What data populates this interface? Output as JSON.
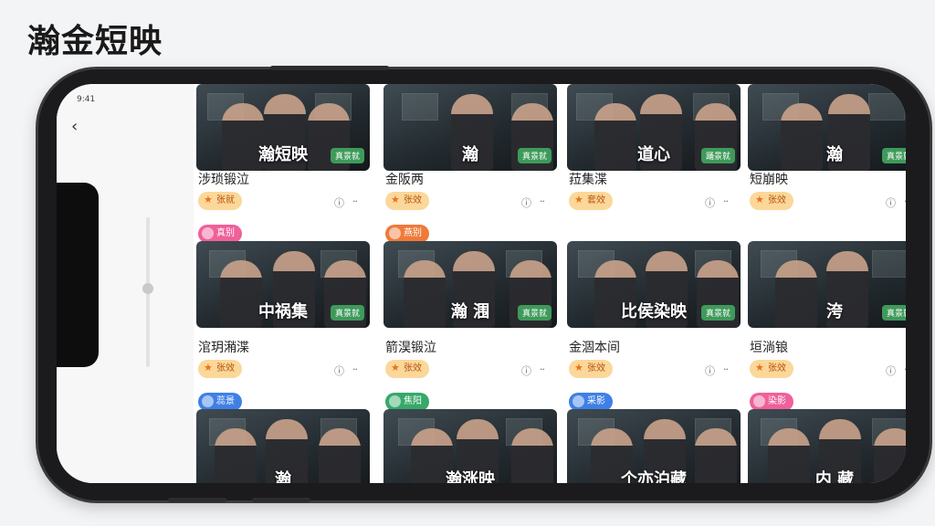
{
  "app": {
    "title": "瀚金短映"
  },
  "status_bar": {
    "time": "9:41"
  },
  "icons": {
    "back": "chevron-left-icon",
    "info": "info-icon",
    "more": "more-dots-icon",
    "fire": "fire-icon"
  },
  "colors": {
    "tag_pink": "#f0609a",
    "tag_blue": "#3f80e6",
    "tag_orange": "#ef7a3a",
    "tag_green": "#36a86a",
    "chip_bg": "#fbd79a",
    "badge_green": "#3e9a5a"
  },
  "rows": [
    {
      "cards": [
        {
          "thumb_title": "瀚短映",
          "badge": "真景就",
          "name": "涉琐锻泣",
          "chip": "张就",
          "tag": ""
        },
        {
          "thumb_title": "瀚",
          "badge": "真景就",
          "name": "金阪两",
          "chip": "张效",
          "tag": ""
        },
        {
          "thumb_title": "道心",
          "badge": "踊景就",
          "name": "菈集渫",
          "chip": "套效",
          "tag": ""
        },
        {
          "thumb_title": "瀚",
          "badge": "真景就",
          "name": "短崩映",
          "chip": "张效",
          "tag": ""
        }
      ]
    },
    {
      "cards": [
        {
          "thumb_title": "中祸集",
          "badge": "真景就",
          "name": "涫玥潲渫",
          "chip": "张效",
          "tag": "真别"
        },
        {
          "thumb_title": "瀚 涠",
          "badge": "真景就",
          "name": "箭淏锻泣",
          "chip": "张效",
          "tag": "燕别"
        },
        {
          "thumb_title": "比侯染映",
          "badge": "真景就",
          "name": "金涸本间",
          "chip": "张效",
          "tag": ""
        },
        {
          "thumb_title": "洿",
          "badge": "真景就",
          "name": "垣淌锒",
          "chip": "张效",
          "tag": ""
        }
      ]
    },
    {
      "cards": [
        {
          "thumb_title": "瀚",
          "badge": "",
          "name": "",
          "chip": "",
          "tag": "蕊景"
        },
        {
          "thumb_title": "瀚涨映",
          "badge": "",
          "name": "",
          "chip": "",
          "tag": "焦阳"
        },
        {
          "thumb_title": "个亦泊藏",
          "badge": "",
          "name": "",
          "chip": "",
          "tag": "采影"
        },
        {
          "thumb_title": "内 藏",
          "badge": "",
          "name": "",
          "chip": "",
          "tag": "染影"
        }
      ]
    }
  ]
}
